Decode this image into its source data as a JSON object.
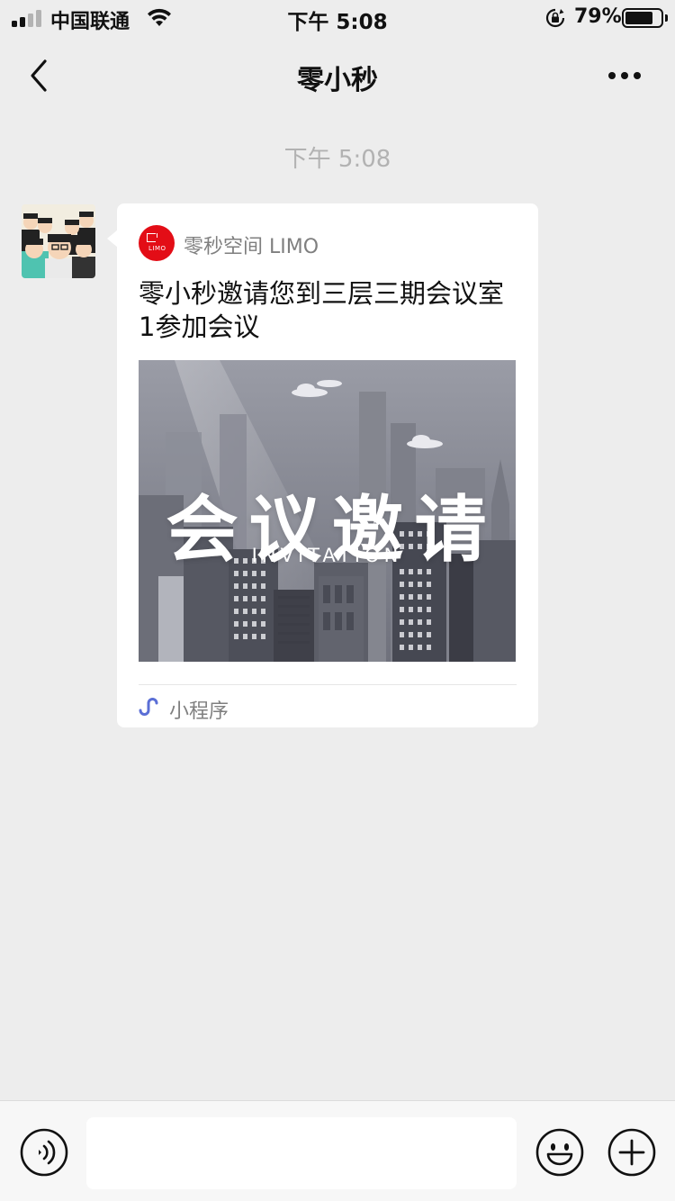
{
  "status_bar": {
    "carrier": "中国联通",
    "time": "下午 5:08",
    "battery_percent": "79%",
    "battery_level": 0.79
  },
  "nav": {
    "title": "零小秒"
  },
  "chat": {
    "timestamp": "下午 5:08",
    "message": {
      "source_name": "零秒空间 LIMO",
      "logo_text": "LIMO",
      "title": "零小秒邀请您到三层三期会议室1参加会议",
      "cover_title": "会议邀请",
      "cover_subtitle": "INVITATION",
      "footer_label": "小程序"
    }
  },
  "colors": {
    "background": "#ededed",
    "card": "#ffffff",
    "logo_red": "#e30d16",
    "mini_program_icon": "#5b6fd6",
    "muted_text": "#7f7f7f"
  },
  "icons": [
    "signal-icon",
    "wifi-icon",
    "orientation-lock-icon",
    "battery-icon",
    "back-icon",
    "more-icon",
    "mini-program-icon",
    "voice-icon",
    "emoji-icon",
    "plus-icon"
  ]
}
